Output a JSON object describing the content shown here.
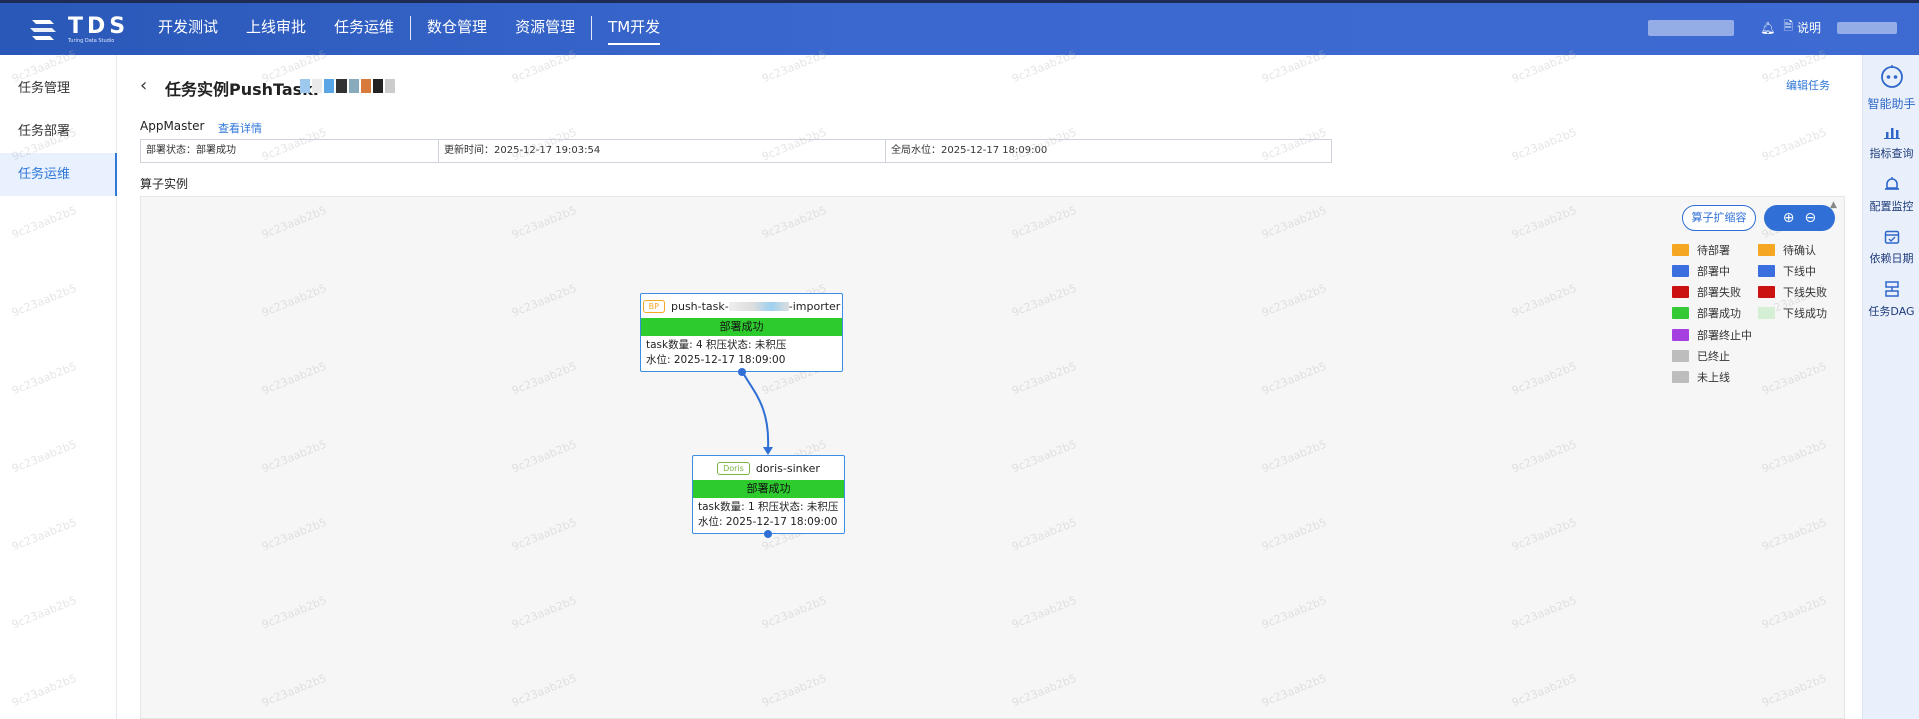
{
  "header": {
    "logo_text": "TDS",
    "logo_sub": "Turing Data Studio",
    "nav": [
      {
        "label": "开发测试"
      },
      {
        "label": "上线审批"
      },
      {
        "label": "任务运维"
      },
      {
        "label": "数仓管理"
      },
      {
        "label": "资源管理"
      },
      {
        "label": "TM开发"
      }
    ],
    "help_label": "说明"
  },
  "sidebar": {
    "items": [
      {
        "label": "任务管理"
      },
      {
        "label": "任务部署"
      },
      {
        "label": "任务运维"
      }
    ]
  },
  "right_toolbar": {
    "items": [
      {
        "label": "智能助手",
        "icon": "robot-icon"
      },
      {
        "label": "指标查询",
        "icon": "bar-chart-icon"
      },
      {
        "label": "配置监控",
        "icon": "alarm-bell-icon"
      },
      {
        "label": "依赖日期",
        "icon": "calendar-icon"
      },
      {
        "label": "任务DAG",
        "icon": "dag-icon"
      }
    ]
  },
  "page": {
    "title": "任务实例PushTaskI",
    "edit_label": "编辑任务",
    "appmaster_label": "AppMaster",
    "detail_link": "查看详情",
    "info": {
      "deploy_status": "部署状态：部署成功",
      "update_time": "更新时间：2025-12-17 19:03:54",
      "global_watermark": "全局水位：2025-12-17 18:09:00"
    },
    "operator_label": "算子实例",
    "expand_button": "算子扩缩容"
  },
  "legend": [
    {
      "label": "待部署",
      "color": "#f5a623"
    },
    {
      "label": "待确认",
      "color": "#f5a623"
    },
    {
      "label": "部署中",
      "color": "#3b6fe0"
    },
    {
      "label": "下线中",
      "color": "#3b6fe0"
    },
    {
      "label": "部署失败",
      "color": "#cc1111"
    },
    {
      "label": "下线失败",
      "color": "#cc1111"
    },
    {
      "label": "部署成功",
      "color": "#36c936"
    },
    {
      "label": "下线成功",
      "color": "#d4efd4"
    },
    {
      "label": "部署终止中",
      "color": "#a63fe0"
    },
    {
      "label": "已终止",
      "color": "#bdbdbd"
    },
    {
      "label": "未上线",
      "color": "#bdbdbd"
    }
  ],
  "nodes": [
    {
      "tag": "BP",
      "tag_color": "#f5a623",
      "name_prefix": "push-task-",
      "name_suffix": "-importer",
      "status": "部署成功",
      "line1": "task数量: 4   积压状态: 未积压",
      "line2": "水位: 2025-12-17 18:09:00"
    },
    {
      "tag": "Doris",
      "tag_color": "#7cb342",
      "name": "doris-sinker",
      "status": "部署成功",
      "line1": "task数量: 1   积压状态: 未积压",
      "line2": "水位: 2025-12-17 18:09:00"
    }
  ],
  "watermark": "9c23aab2b5"
}
